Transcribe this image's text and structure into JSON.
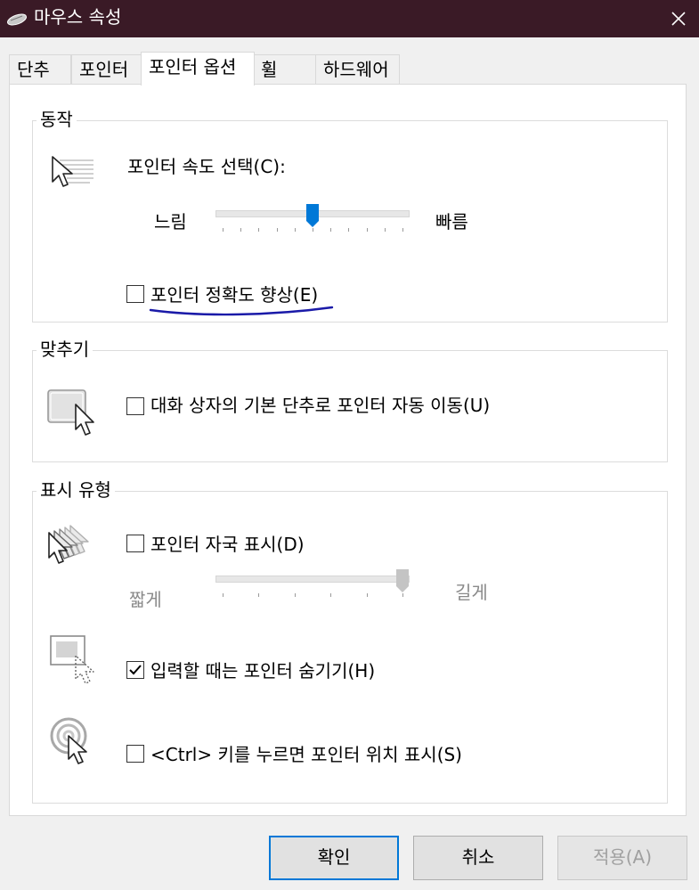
{
  "window": {
    "title": "마우스 속성",
    "close_glyph": "✕"
  },
  "tabs": [
    {
      "label": "단추"
    },
    {
      "label": "포인터"
    },
    {
      "label": "포인터 옵션",
      "active": true
    },
    {
      "label": "휠"
    },
    {
      "label": "하드웨어"
    }
  ],
  "motion": {
    "group_label": "동작",
    "speed_label": "포인터 속도 선택(C):",
    "slow_label": "느림",
    "fast_label": "빠름",
    "speed_value": 6,
    "speed_max": 11,
    "precision_label": "포인터 정확도 향상(E)",
    "precision_checked": false
  },
  "snap": {
    "group_label": "맞추기",
    "snap_label": "대화 상자의 기본 단추로 포인터 자동 이동(U)",
    "snap_checked": false
  },
  "visibility": {
    "group_label": "표시 유형",
    "trails_label": "포인터 자국 표시(D)",
    "trails_checked": false,
    "trails_short_label": "짧게",
    "trails_long_label": "길게",
    "trails_value": 6,
    "trails_max": 6,
    "hide_label": "입력할 때는 포인터 숨기기(H)",
    "hide_checked": true,
    "ctrl_label": "<Ctrl> 키를 누르면 포인터 위치 표시(S)",
    "ctrl_checked": false
  },
  "buttons": {
    "ok": "확인",
    "cancel": "취소",
    "apply": "적용(A)"
  },
  "icons": {
    "title": "mouse-icon",
    "speed": "pointer-speed-icon",
    "snap": "snap-to-icon",
    "trails": "pointer-trails-icon",
    "hide": "hide-pointer-icon",
    "ctrl": "show-location-icon",
    "check": "checkmark-icon"
  },
  "colors": {
    "titlebar": "#3a1a26",
    "accent": "#0078d7",
    "annotation": "#1a1aa8"
  }
}
